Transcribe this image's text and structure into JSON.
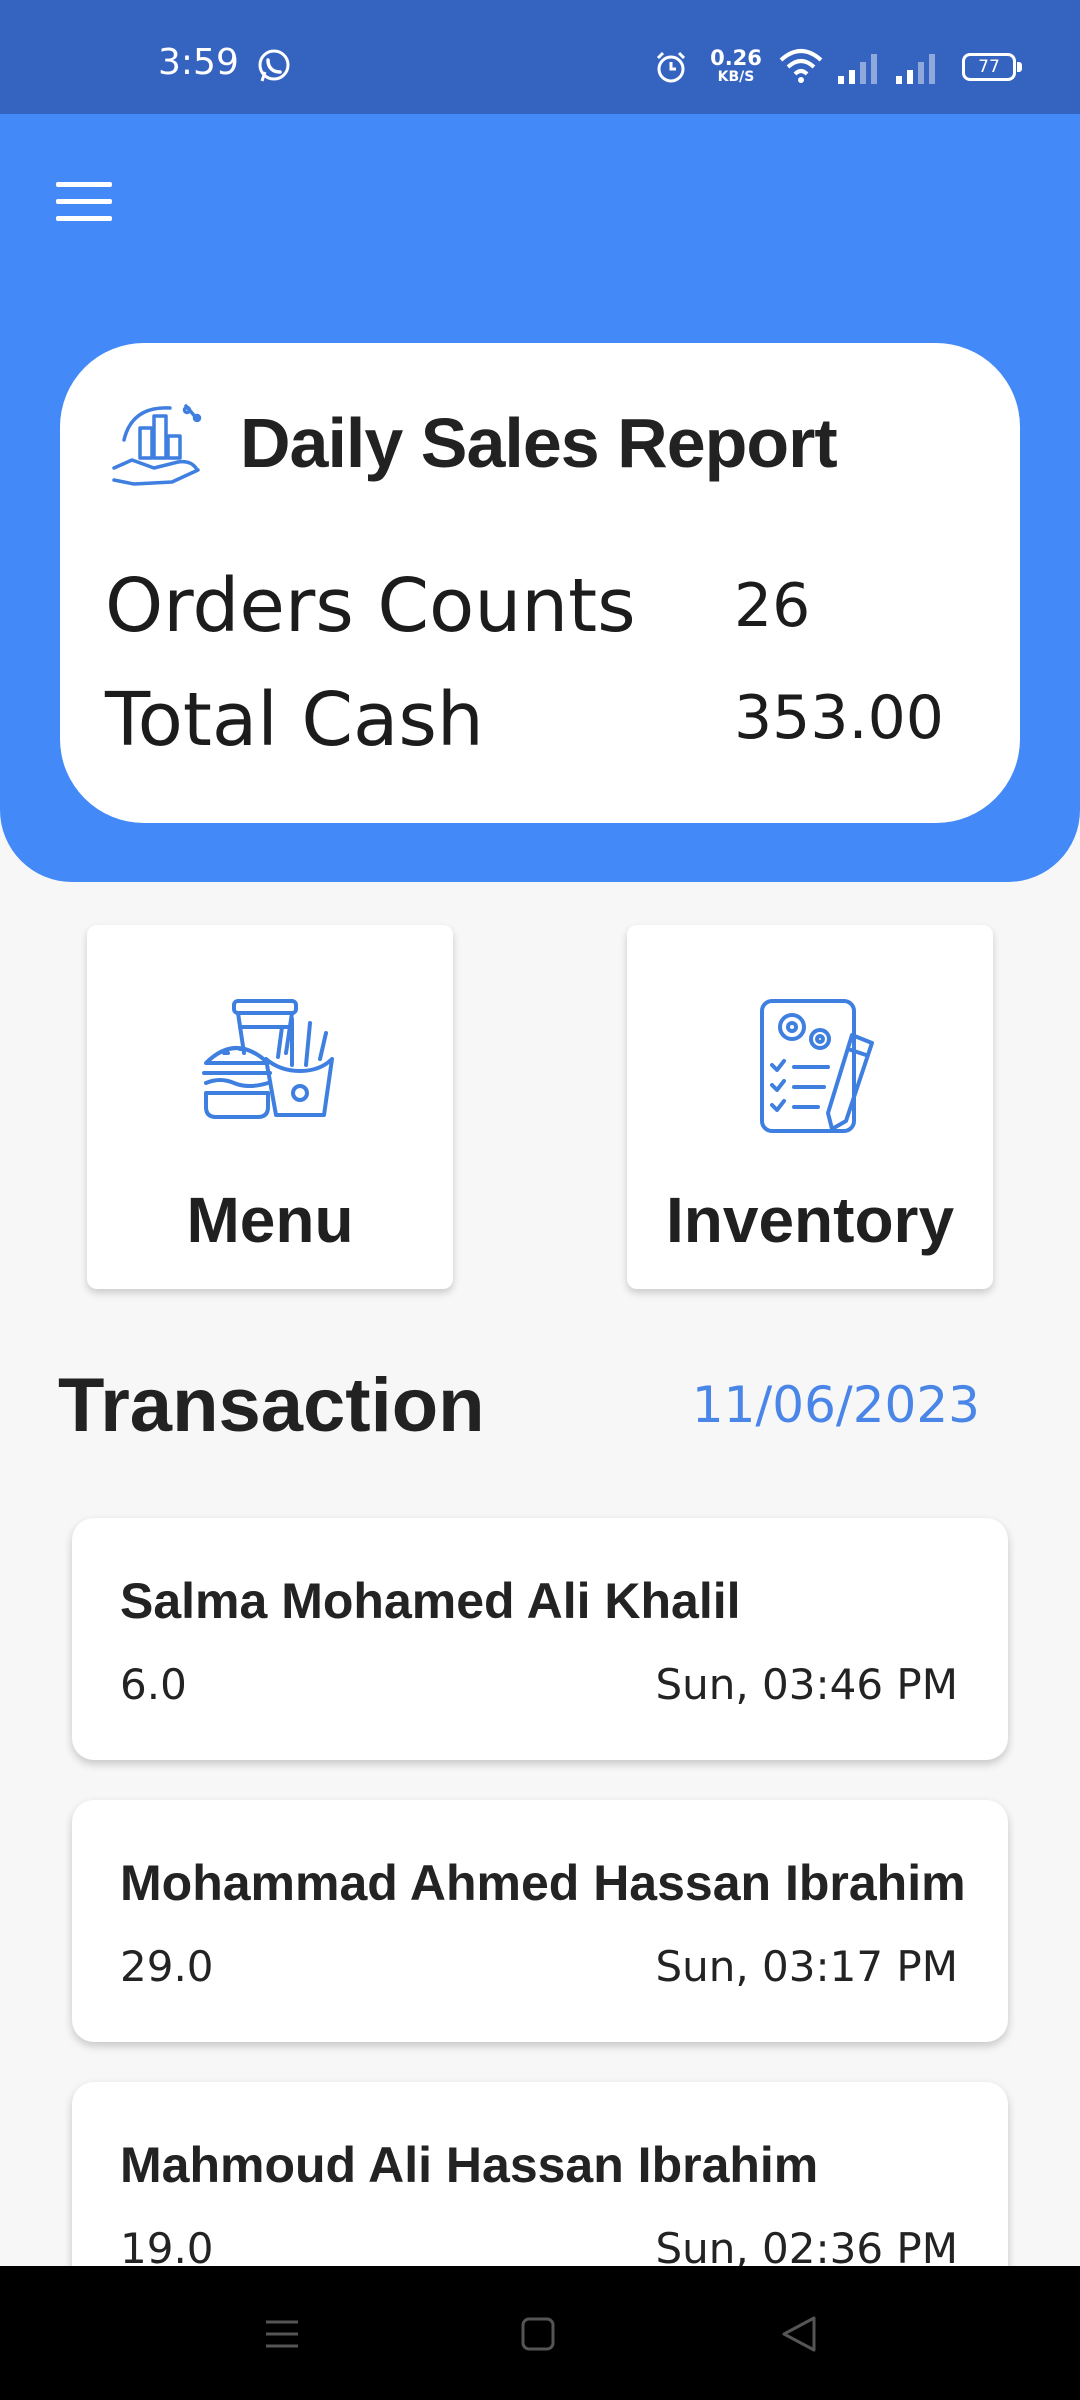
{
  "status_bar": {
    "time": "3:59",
    "network_speed_value": "0.26",
    "network_speed_unit": "KB/S",
    "battery": "77"
  },
  "report": {
    "title": "Daily Sales Report",
    "orders_label": "Orders Counts",
    "orders_value": "26",
    "cash_label": "Total Cash",
    "cash_value": "353.00"
  },
  "tiles": {
    "menu_label": "Menu",
    "inventory_label": "Inventory"
  },
  "transactions": {
    "title": "Transaction",
    "date": "11/06/2023",
    "items": [
      {
        "name": "Salma Mohamed Ali Khalil",
        "amount": "6.0",
        "time": "Sun, 03:46 PM"
      },
      {
        "name": "Mohammad Ahmed Hassan Ibrahim",
        "amount": "29.0",
        "time": "Sun, 03:17 PM"
      },
      {
        "name": "Mahmoud Ali Hassan Ibrahim",
        "amount": "19.0",
        "time": "Sun, 02:36 PM"
      }
    ]
  },
  "colors": {
    "status_bar": "#3563c0",
    "header": "#438af8",
    "accent_date": "#4a86e8",
    "icon_blue": "#3f7fe0"
  },
  "icons": {
    "whatsapp": "whatsapp-icon",
    "alarm": "alarm-icon",
    "wifi": "wifi-icon",
    "signal": "signal-icon",
    "battery": "battery-icon",
    "hamburger": "hamburger-menu-icon",
    "report": "sales-report-icon",
    "menu_tile": "fast-food-icon",
    "inventory_tile": "inventory-checklist-icon"
  }
}
